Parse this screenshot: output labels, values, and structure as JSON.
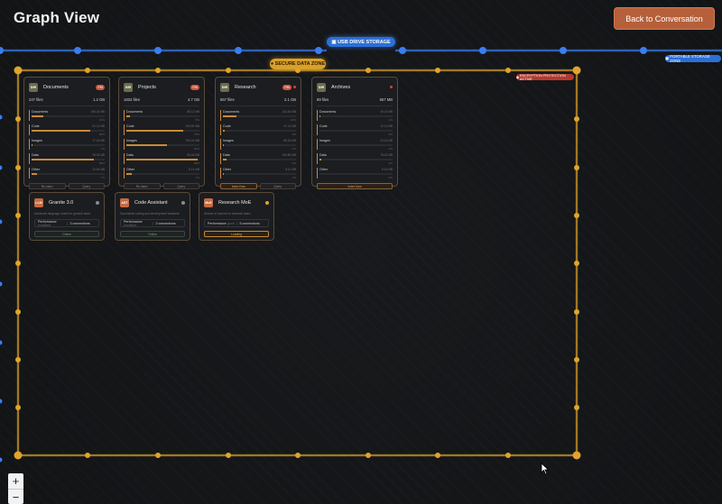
{
  "header": {
    "title": "Graph View",
    "back_label": "Back to Conversation"
  },
  "zones": {
    "usb": "USB DRIVE STORAGE",
    "portable": "PORTABLE STORAGE ZONE",
    "secure": "SECURE DATA ZONE",
    "encryption": "ENCRYPTION PROTECTION ACTIVE"
  },
  "colors": {
    "usb_wire": "#3b7df0",
    "secure_wire": "#e0a42c",
    "accent": "#b5603a"
  },
  "directories": [
    {
      "icon": "DIR",
      "name": "Documents",
      "badge": "PIN",
      "files": "247 files",
      "size": "1.2 GB",
      "categories": [
        {
          "label": "Documents",
          "value": "195.34 MB",
          "pct": "16%",
          "fill": 0.16
        },
        {
          "label": "Code",
          "value": "51.21 MB",
          "pct": "80%",
          "fill": 0.8
        },
        {
          "label": "Images",
          "value": "17.15 MB",
          "pct": "1%",
          "fill": 0.01
        },
        {
          "label": "Data",
          "value": "28.33 MB",
          "pct": "85%",
          "fill": 0.85
        },
        {
          "label": "Other",
          "value": "12.54 MB",
          "pct": "7%",
          "fill": 0.07
        }
      ],
      "actions": [
        "Re-index",
        "Query"
      ]
    },
    {
      "icon": "DIR",
      "name": "Projects",
      "badge": "PIN",
      "files": "1834 files",
      "size": "4.7 GB",
      "categories": [
        {
          "label": "Documents",
          "value": "85.12 MB",
          "pct": "5%",
          "fill": 0.05
        },
        {
          "label": "Code",
          "value": "194.52 MB",
          "pct": "78%",
          "fill": 0.78
        },
        {
          "label": "Images",
          "value": "754.16 MB",
          "pct": "56%",
          "fill": 0.56
        },
        {
          "label": "Data",
          "value": "96.18 MB",
          "pct": "98%",
          "fill": 0.98
        },
        {
          "label": "Other",
          "value": "8.14 MB",
          "pct": "7%",
          "fill": 0.07
        }
      ],
      "actions": [
        "Re-index",
        "Query"
      ]
    },
    {
      "icon": "DIR",
      "name": "Research",
      "badge": "PIN",
      "files": "567 files",
      "size": "2.1 GB",
      "categories": [
        {
          "label": "Documents",
          "value": "134.44 MB",
          "pct": "18%",
          "fill": 0.18
        },
        {
          "label": "Code",
          "value": "47.14 MB",
          "pct": "3%",
          "fill": 0.03
        },
        {
          "label": "Images",
          "value": "85.18 MB",
          "pct": "1%",
          "fill": 0.01
        },
        {
          "label": "Data",
          "value": "195.86 MB",
          "pct": "5%",
          "fill": 0.05
        },
        {
          "label": "Other",
          "value": "8.11 MB",
          "pct": "1%",
          "fill": 0.01
        }
      ],
      "actions": [
        "Index Now",
        "Query"
      ]
    },
    {
      "icon": "DIR",
      "name": "Archives",
      "badge": "",
      "files": "89 files",
      "size": "567 MB",
      "categories": [
        {
          "label": "Documents",
          "value": "45.15 MB",
          "pct": "1%",
          "fill": 0.01
        },
        {
          "label": "Code",
          "value": "12.13 MB",
          "pct": "0%",
          "fill": 0.0
        },
        {
          "label": "Images",
          "value": "23.14 MB",
          "pct": "0%",
          "fill": 0.0
        },
        {
          "label": "Data",
          "value": "78.42 MB",
          "pct": "2%",
          "fill": 0.02
        },
        {
          "label": "Other",
          "value": "8.13 MB",
          "pct": "0%",
          "fill": 0.0
        }
      ],
      "actions": [
        "Index Now"
      ]
    }
  ],
  "models": [
    {
      "icon": "LLM",
      "name": "Granite 3.0",
      "desc": "Advanced language model for general tasks",
      "perf_label": "Performance",
      "perf": "excellent",
      "conn": "3 connections",
      "status": "Online",
      "loading": false
    },
    {
      "icon": "AST",
      "name": "Code Assistant",
      "desc": "Specialized coding and development assistant",
      "perf_label": "Performance",
      "perf": "excellent",
      "conn": "2 connections",
      "status": "Online",
      "loading": false
    },
    {
      "icon": "MoE",
      "name": "Research MoE",
      "desc": "Mixture of experts for research tasks",
      "perf_label": "Performance",
      "perf": "good",
      "conn": "5 connections",
      "status": "Loading",
      "loading": true
    }
  ],
  "zoom": {
    "in": "+",
    "out": "−"
  }
}
